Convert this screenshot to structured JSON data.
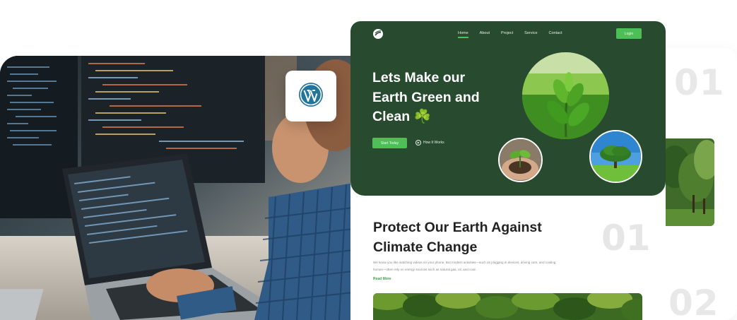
{
  "wordpress_badge": {
    "icon": "wordpress-icon",
    "color": "#21759b"
  },
  "back_card": {
    "number_1": "01",
    "number_2": "02"
  },
  "site": {
    "nav": {
      "items": [
        "Home",
        "About",
        "Project",
        "Service",
        "Contact"
      ],
      "active": "Home",
      "login_label": "Login"
    },
    "hero": {
      "title_lines": [
        "Lets Make our",
        "Earth Green and",
        "Clean ☘️"
      ],
      "start_button": "Start Today",
      "how_link": "How It Works"
    },
    "section": {
      "title_lines": [
        "Protect Our Earth Against",
        "Climate Change"
      ],
      "number": "01",
      "body": "We know you like watching videos on your phone. But modern activities—such as plugging in devices, driving cars, and cooling homes—often rely on energy sources such as natural gas, oil, and coal.",
      "read_more": "Read More"
    }
  },
  "colors": {
    "hero_bg": "#284b2f",
    "accent": "#4cbf57"
  }
}
